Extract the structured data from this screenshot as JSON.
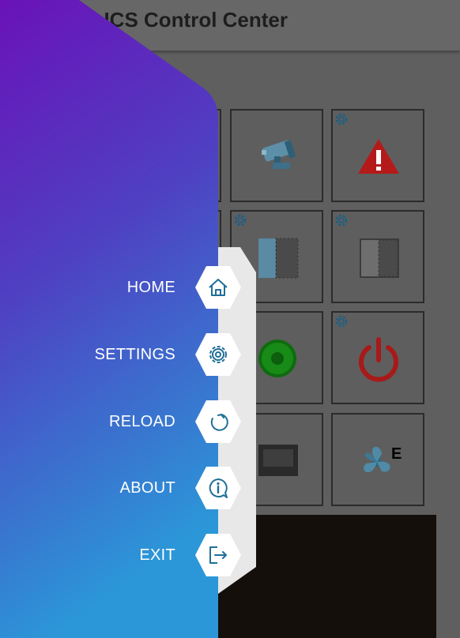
{
  "app": {
    "title": "VA ICS Control Center"
  },
  "menu": {
    "items": [
      {
        "label": "HOME",
        "icon": "home-icon"
      },
      {
        "label": "SETTINGS",
        "icon": "gear-icon"
      },
      {
        "label": "RELOAD",
        "icon": "reload-icon"
      },
      {
        "label": "ABOUT",
        "icon": "info-icon"
      },
      {
        "label": "EXIT",
        "icon": "exit-icon"
      }
    ]
  },
  "dashboard": {
    "tiles": [
      {
        "name": "security-camera",
        "icon": "camera-icon"
      },
      {
        "name": "alarm",
        "icon": "warning-icon"
      },
      {
        "name": "door-left",
        "icon": "door-icon"
      },
      {
        "name": "door-right",
        "icon": "door-icon"
      },
      {
        "name": "status",
        "icon": "status-light-icon"
      },
      {
        "name": "power",
        "icon": "power-icon"
      },
      {
        "name": "heater",
        "icon": "heater-icon"
      },
      {
        "name": "exhaust-fan",
        "icon": "fan-icon",
        "badge": "E"
      }
    ]
  },
  "colors": {
    "drawer_gradient_top": "#6a12b8",
    "drawer_gradient_mid": "#4f40c2",
    "drawer_gradient_bottom": "#2b97d8",
    "icon_blue": "#1f6f98",
    "hex_white": "#ffffff",
    "scrim": "#5f5f5f"
  }
}
